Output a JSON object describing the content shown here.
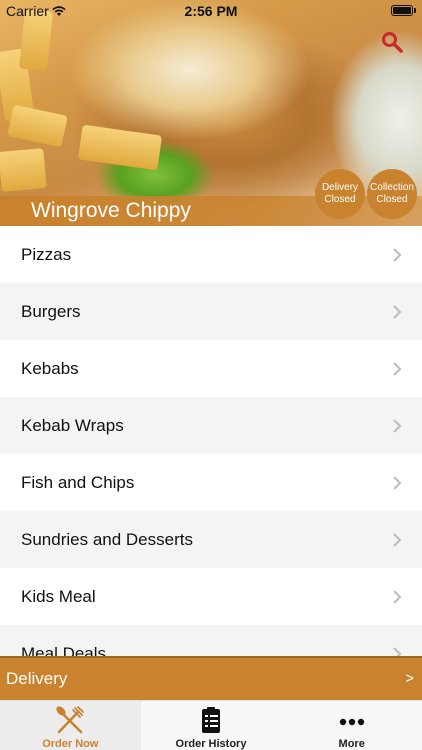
{
  "status_bar": {
    "carrier": "Carrier",
    "time": "2:56 PM"
  },
  "header": {
    "restaurant_name": "Wingrove Chippy",
    "search_icon": "search-icon",
    "delivery_status": {
      "line1": "Delivery",
      "line2": "Closed"
    },
    "collection_status": {
      "line1": "Collection",
      "line2": "Closed"
    }
  },
  "categories": [
    {
      "label": "Pizzas"
    },
    {
      "label": "Burgers"
    },
    {
      "label": "Kebabs"
    },
    {
      "label": "Kebab Wraps"
    },
    {
      "label": "Fish and Chips"
    },
    {
      "label": "Sundries and Desserts"
    },
    {
      "label": "Kids Meal"
    },
    {
      "label": "Meal Deals"
    }
  ],
  "order_mode": {
    "label": "Delivery",
    "arrow": ">"
  },
  "tabbar": {
    "tabs": [
      {
        "label": "Order Now",
        "icon": "fork-knife-icon",
        "active": true
      },
      {
        "label": "Order History",
        "icon": "clipboard-icon",
        "active": false
      },
      {
        "label": "More",
        "icon": "more-dots-icon",
        "active": false
      }
    ]
  },
  "colors": {
    "accent": "#c9822d",
    "list_alt": "#f4f4f4",
    "tab_bg": "#f7f7f7"
  }
}
